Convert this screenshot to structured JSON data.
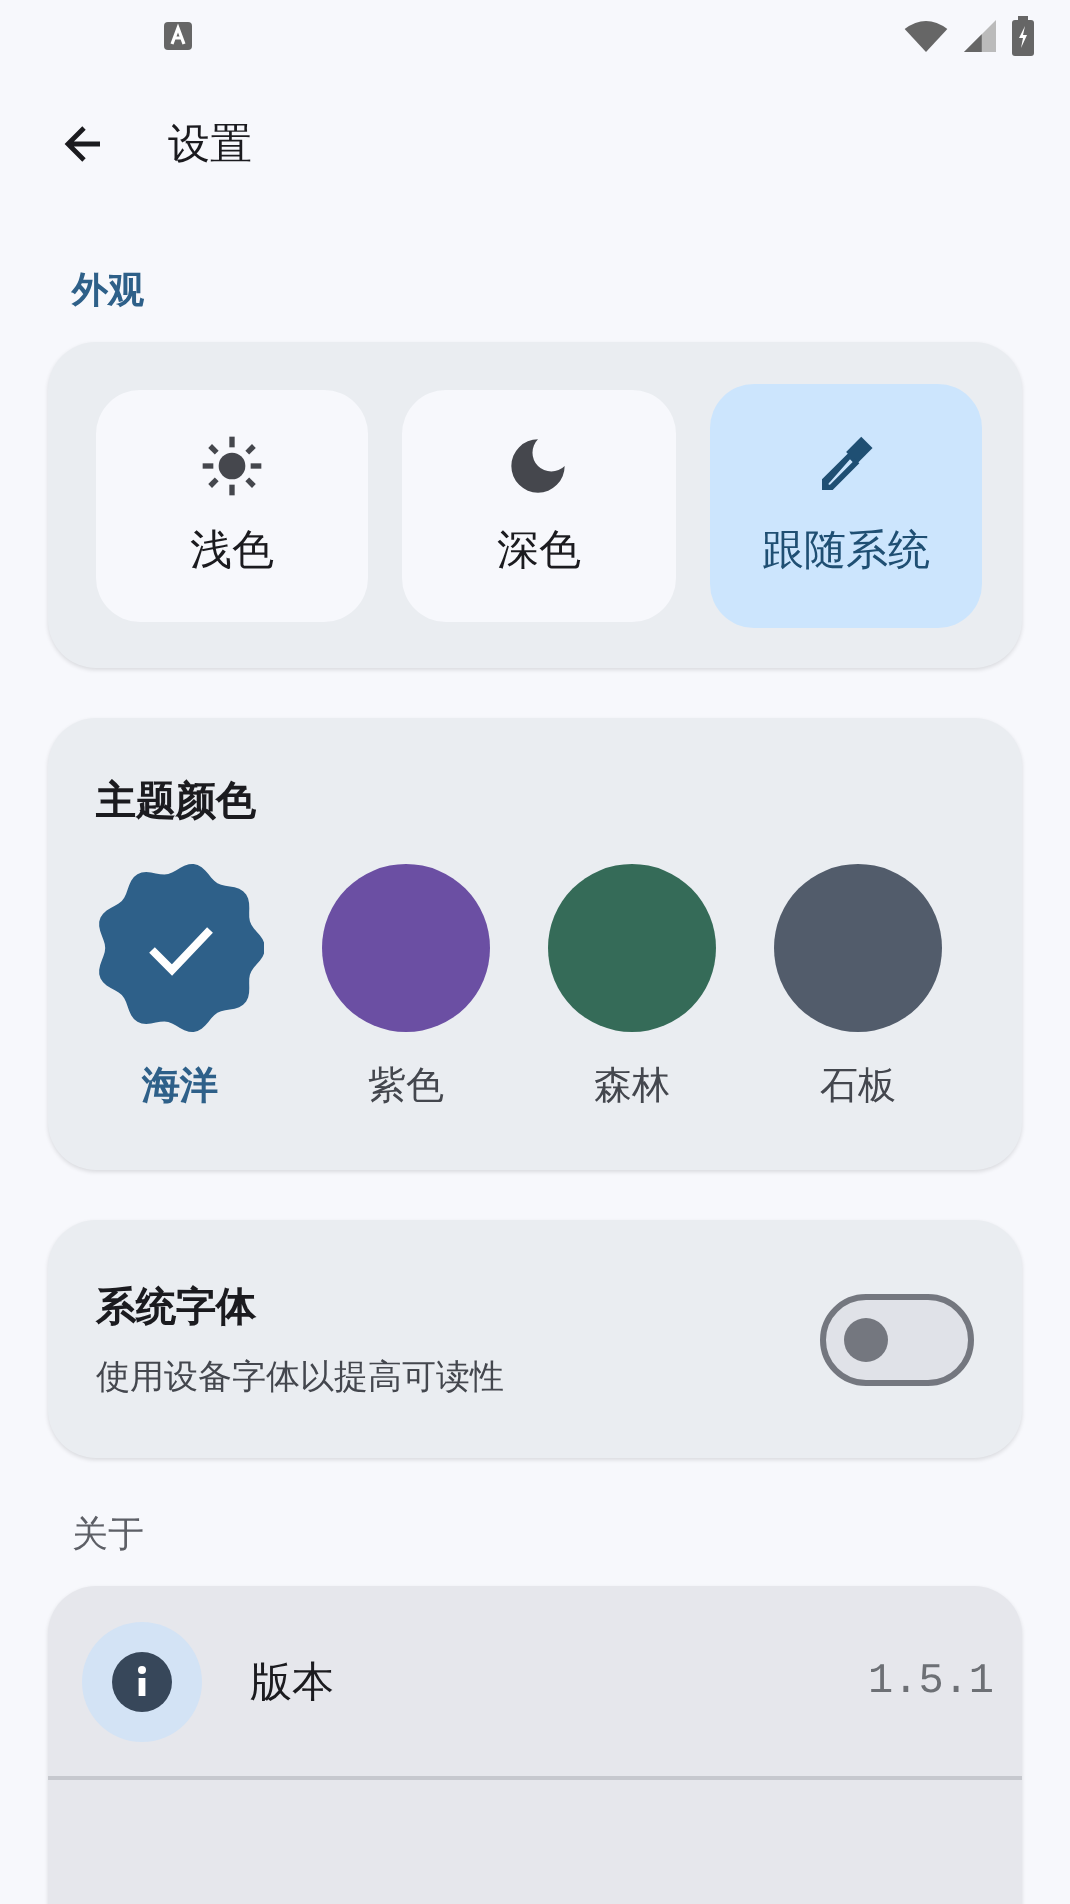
{
  "app_bar": {
    "title": "设置"
  },
  "appearance": {
    "label": "外观",
    "modes": [
      {
        "kind": "light",
        "label": "浅色",
        "selected": false
      },
      {
        "kind": "dark",
        "label": "深色",
        "selected": false
      },
      {
        "kind": "system",
        "label": "跟随系统",
        "selected": true
      }
    ]
  },
  "theme": {
    "title": "主题颜色",
    "colors": [
      {
        "label": "海洋",
        "color": "#2e6089",
        "selected": true
      },
      {
        "label": "紫色",
        "color": "#6b4fa3",
        "selected": false
      },
      {
        "label": "森林",
        "color": "#356b58",
        "selected": false
      },
      {
        "label": "石板",
        "color": "#525c6b",
        "selected": false
      }
    ]
  },
  "system_font": {
    "title": "系统字体",
    "subtitle": "使用设备字体以提高可读性",
    "on": false
  },
  "about": {
    "label": "关于",
    "items": [
      {
        "label": "版本",
        "value": "1.5.1"
      }
    ]
  }
}
